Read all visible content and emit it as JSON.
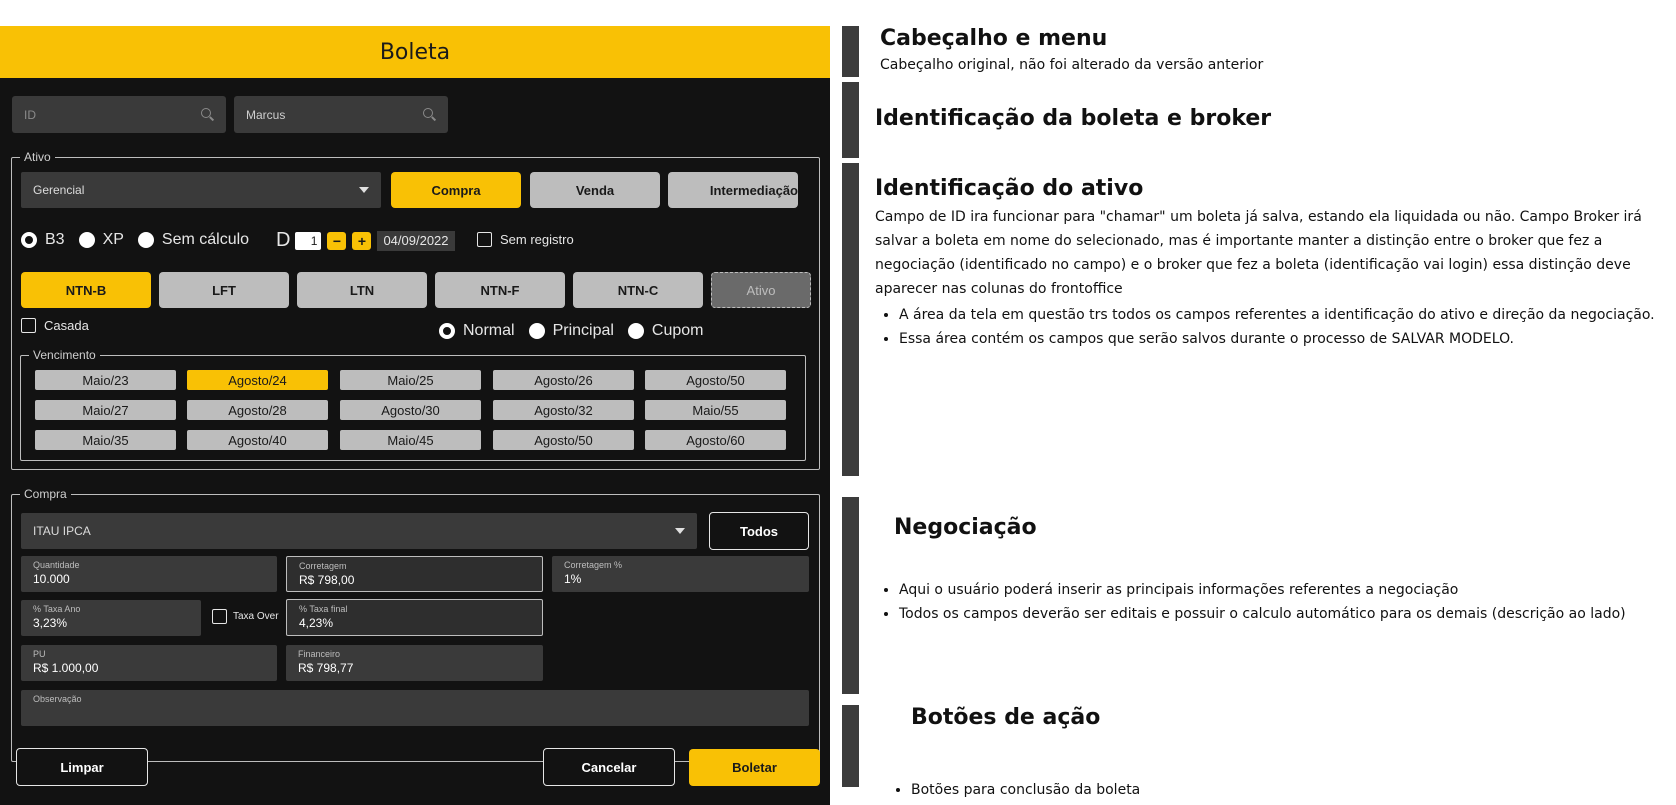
{
  "form": {
    "title": "Boleta",
    "id_search": {
      "placeholder": "ID"
    },
    "broker_search": {
      "value": "Marcus"
    },
    "ativo": {
      "legend": "Ativo",
      "tipo_select": "Gerencial",
      "direction_buttons": [
        "Compra",
        "Venda",
        "Intermediação"
      ],
      "calc_options": [
        "B3",
        "XP",
        "Sem cálculo"
      ],
      "d_label": "D",
      "d_value": "1",
      "minus": "−",
      "plus": "+",
      "date": "04/09/2022",
      "sem_registro": "Sem registro",
      "titulo_buttons": [
        "NTN-B",
        "LFT",
        "LTN",
        "NTN-F",
        "NTN-C"
      ],
      "ativo_button": "Ativo",
      "casada": "Casada",
      "modo_options": [
        "Normal",
        "Principal",
        "Cupom"
      ]
    },
    "vencimento": {
      "legend": "Vencimento",
      "rows": [
        [
          "Maio/23",
          "Agosto/24",
          "Maio/25",
          "Agosto/26",
          "Agosto/50"
        ],
        [
          "Maio/27",
          "Agosto/28",
          "Agosto/30",
          "Agosto/32",
          "Maio/55"
        ],
        [
          "Maio/35",
          "Agosto/40",
          "Maio/45",
          "Agosto/50",
          "Agosto/60"
        ]
      ],
      "selected": "Agosto/24"
    },
    "compra": {
      "legend": "Compra",
      "conta_select": "ITAU IPCA",
      "todos_button": "Todos",
      "quantidade": {
        "label": "Quantidade",
        "value": "10.000"
      },
      "corretagem": {
        "label": "Corretagem",
        "value": "R$ 798,00"
      },
      "corretagem_pct": {
        "label": "Corretagem %",
        "value": "1%"
      },
      "taxa_ano": {
        "label": "% Taxa Ano",
        "value": "3,23%"
      },
      "taxa_over": "Taxa Over",
      "taxa_final": {
        "label": "% Taxa final",
        "value": "4,23%"
      },
      "pu": {
        "label": "PU",
        "value": "R$ 1.000,00"
      },
      "financeiro": {
        "label": "Financeiro",
        "value": "R$ 798,77"
      },
      "observacao": {
        "label": "Observação",
        "value": ""
      }
    },
    "actions": {
      "limpar": "Limpar",
      "cancelar": "Cancelar",
      "boletar": "Boletar"
    }
  },
  "notes": {
    "cabecalho": {
      "title": "Cabeçalho e menu",
      "text": "Cabeçalho original, não foi alterado da versão anterior"
    },
    "identificacao_boleta": {
      "title": "Identificação da boleta e broker"
    },
    "identificacao_ativo": {
      "title": "Identificação do ativo",
      "text": "Campo de ID ira funcionar para \"chamar\" um boleta já salva, estando ela liquidada ou não. Campo Broker irá salvar a boleta em nome do selecionado, mas é importante manter a distinção entre o broker que fez a negociação (identificado no campo) e o broker que fez a boleta (identificação vai login) essa distinção deve aparecer nas colunas do frontoffice",
      "bullets": [
        "A área da tela em questão trs todos os campos referentes a identificação do ativo e direção da negociação.",
        "Essa área contém os campos que serão salvos durante o processo de SALVAR MODELO."
      ]
    },
    "negociacao": {
      "title": "Negociação",
      "bullets": [
        "Aqui o usuário poderá inserir as principais informações referentes a negociação",
        "Todos os campos deverão ser editais e possuir o calculo automático para os demais (descrição ao lado)"
      ]
    },
    "botoes": {
      "title": "Botões de ação",
      "bullets": [
        "Botões para conclusão  da boleta"
      ]
    }
  },
  "colors": {
    "accent": "#f9c105",
    "panel_bg": "#121212",
    "field_bg": "#3a3a3a",
    "button_gray": "#bdbdbd"
  }
}
